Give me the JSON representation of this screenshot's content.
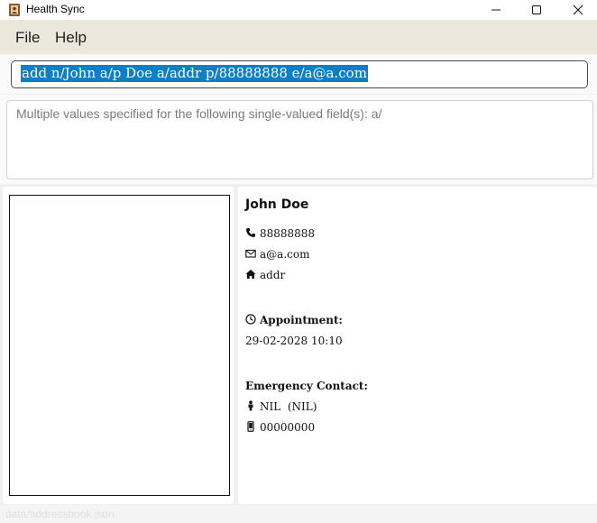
{
  "window": {
    "title": "Health Sync",
    "app_icon": "address-book-icon",
    "controls": [
      "minimize-icon",
      "maximize-icon",
      "close-icon"
    ]
  },
  "menu": {
    "items": [
      {
        "label": "File"
      },
      {
        "label": "Help"
      }
    ]
  },
  "command_box": {
    "value": "add n/John a/p Doe a/addr p/88888888 e/a@a.com",
    "selected": true,
    "selection_color": "#0d7fc4"
  },
  "result_display": {
    "text": "Multiple values specified for the following single-valued field(s): a/"
  },
  "person": {
    "name": "John Doe",
    "phone": "88888888",
    "phone_icon": "phone-icon",
    "email": "a@a.com",
    "email_icon": "envelope-icon",
    "address": "addr",
    "address_icon": "home-icon",
    "appointment_label": "Appointment:",
    "appointment_icon": "clock-icon",
    "appointment_value": "29-02-2028 10:10",
    "emergency_label": "Emergency Contact:",
    "emergency_name": "NIL  (NIL)",
    "emergency_name_icon": "person-icon",
    "emergency_phone": "00000000",
    "emergency_phone_icon": "mobile-phone-icon"
  },
  "status_bar": {
    "text": "data/addressbook.json"
  }
}
